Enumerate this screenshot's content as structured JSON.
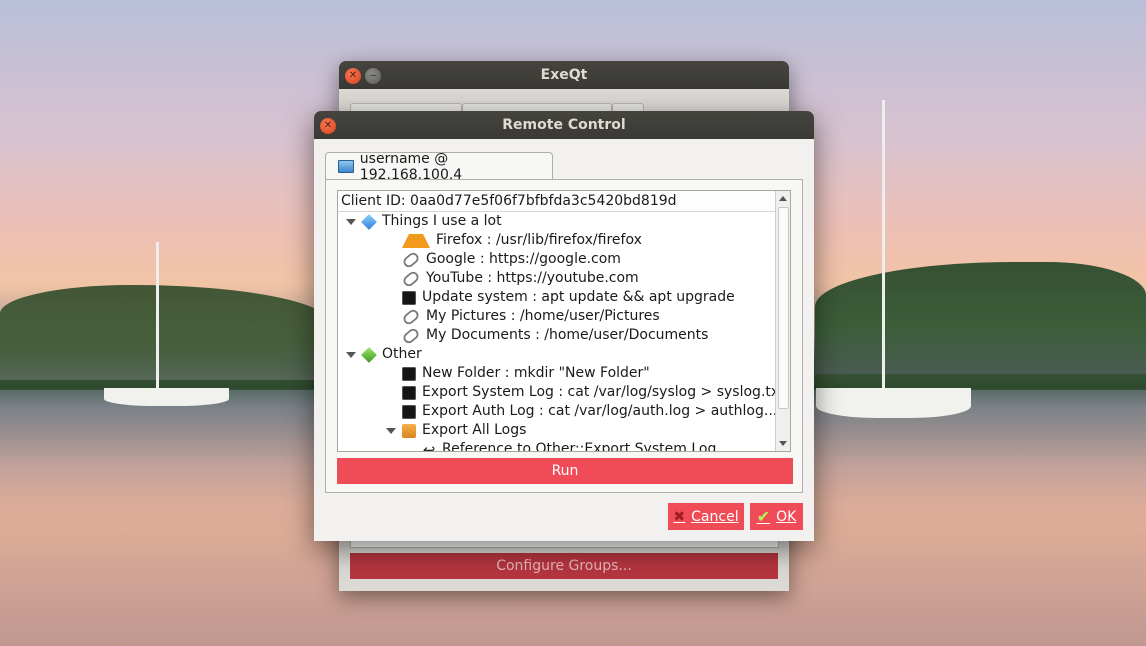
{
  "background_window": {
    "title": "ExeQt",
    "configure_button": "Configure Groups..."
  },
  "dialog": {
    "title": "Remote Control",
    "tab_label": "username @ 192.168.100.4",
    "client_id": "Client ID: 0aa0d77e5f06f7bfbfda3c5420bd819d",
    "tree": [
      {
        "label": "Things I use a lot",
        "icon": "blue-diamond-icon",
        "level": 0,
        "expanded": true
      },
      {
        "label": "Firefox : /usr/lib/firefox/firefox",
        "icon": "app-icon",
        "level": 1
      },
      {
        "label": "Google : https://google.com",
        "icon": "link-icon",
        "level": 1
      },
      {
        "label": "YouTube : https://youtube.com",
        "icon": "link-icon",
        "level": 1
      },
      {
        "label": "Update system : apt update && apt upgrade",
        "icon": "terminal-icon",
        "level": 1
      },
      {
        "label": "My Pictures : /home/user/Pictures",
        "icon": "link-icon",
        "level": 1
      },
      {
        "label": "My Documents : /home/user/Documents",
        "icon": "link-icon",
        "level": 1
      },
      {
        "label": "Other",
        "icon": "green-diamond-icon",
        "level": 0,
        "expanded": true
      },
      {
        "label": "New Folder : mkdir \"New Folder\"",
        "icon": "terminal-icon",
        "level": 1
      },
      {
        "label": "Export System Log : cat /var/log/syslog > syslog.txt",
        "icon": "terminal-icon",
        "level": 1
      },
      {
        "label": "Export Auth Log : cat /var/log/auth.log > authlog....",
        "icon": "terminal-icon",
        "level": 1
      },
      {
        "label": "Export All Logs",
        "icon": "box-icon",
        "level": 1,
        "expanded": true
      },
      {
        "label": "Reference to Other::Export System Log",
        "icon": "return-icon",
        "level": 2
      }
    ],
    "run_button": "Run",
    "cancel_button": "Cancel",
    "ok_button": "OK"
  },
  "colors": {
    "accent": "#ef4c57",
    "titlebar": "#3c3b37"
  }
}
